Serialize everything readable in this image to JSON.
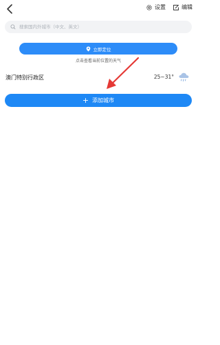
{
  "header": {
    "settings_label": "设置",
    "edit_label": "编辑"
  },
  "search": {
    "placeholder": "搜索国内外城市（中文、英文）"
  },
  "location": {
    "button_label": "立即定位",
    "hint": "点击查看当前位置的天气"
  },
  "cities": [
    {
      "name": "澳门特别行政区",
      "temp_range": "25~31°",
      "weather_icon": "rain-cloud-icon"
    }
  ],
  "add_city": {
    "label": "添加城市"
  },
  "colors": {
    "primary": "#1e88f5",
    "locate": "#2d8cf8",
    "annotation": "#e53935"
  }
}
